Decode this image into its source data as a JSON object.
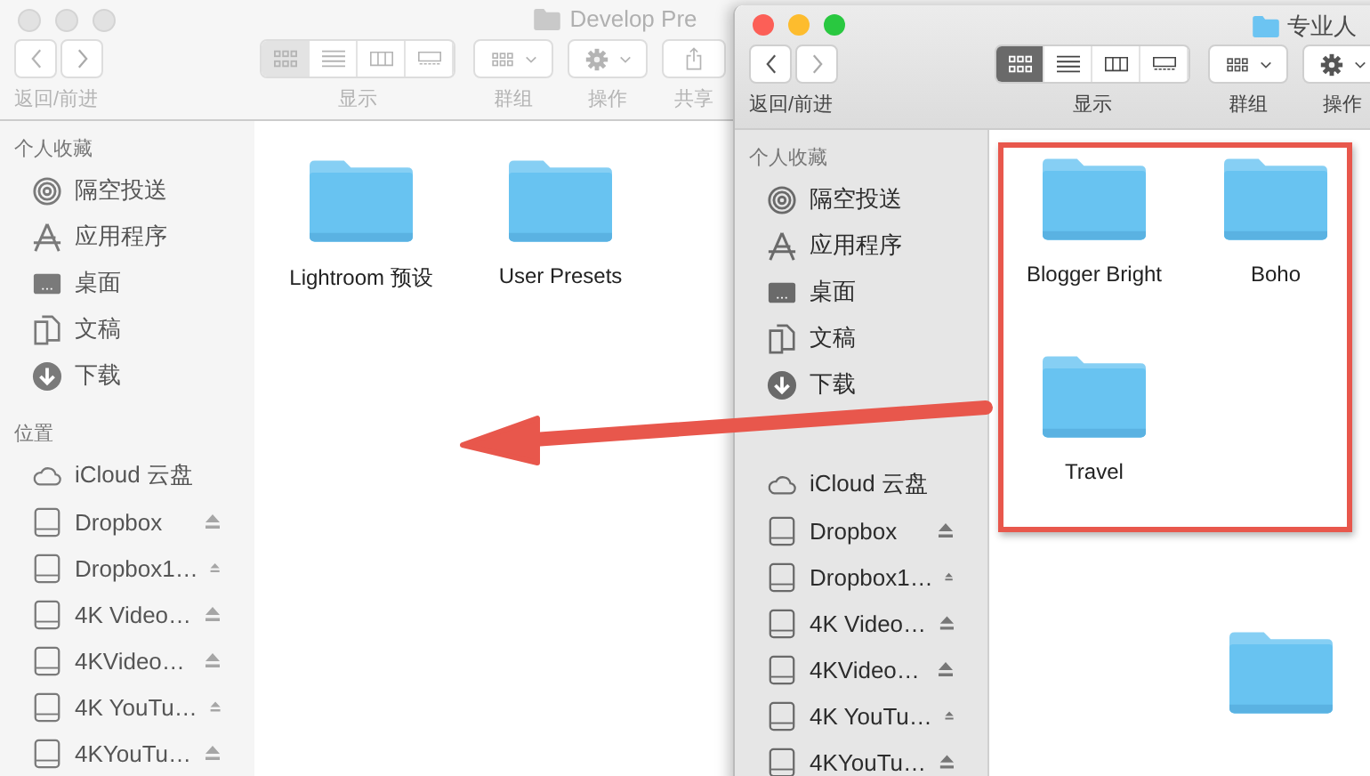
{
  "windows": [
    {
      "title": "Develop Pre",
      "active": false,
      "toolbar": {
        "nav_label": "返回/前进",
        "view_label": "显示",
        "group_label": "群组",
        "action_label": "操作",
        "share_label": "共享",
        "view_modes": [
          {
            "kind": "icon",
            "selected": true
          },
          {
            "kind": "list",
            "selected": false
          },
          {
            "kind": "column",
            "selected": false
          },
          {
            "kind": "gallery",
            "selected": false
          }
        ]
      },
      "sidebar": [
        {
          "heading": "个人收藏",
          "items": [
            {
              "kind": "airdrop",
              "label": "隔空投送"
            },
            {
              "kind": "apps",
              "label": "应用程序"
            },
            {
              "kind": "desktop",
              "label": "桌面"
            },
            {
              "kind": "documents",
              "label": "文稿"
            },
            {
              "kind": "downloads",
              "label": "下载"
            }
          ]
        },
        {
          "heading": "位置",
          "items": [
            {
              "kind": "icloud",
              "label": "iCloud 云盘"
            },
            {
              "kind": "disk",
              "label": "Dropbox"
            },
            {
              "kind": "disk",
              "label": "Dropbox1…"
            },
            {
              "kind": "disk",
              "label": "4K Video…"
            },
            {
              "kind": "disk",
              "label": "4KVideo…"
            },
            {
              "kind": "disk",
              "label": "4K YouTu…"
            },
            {
              "kind": "disk",
              "label": "4KYouTu…"
            }
          ]
        }
      ],
      "groups": [
        {
          "highlighted": false,
          "items": [
            {
              "kind": "folder",
              "name": "Lightroom 预设"
            },
            {
              "kind": "folder",
              "name": "User Presets"
            }
          ]
        }
      ]
    },
    {
      "title": "专业人",
      "active": true,
      "toolbar": {
        "nav_label": "返回/前进",
        "view_label": "显示",
        "group_label": "群组",
        "action_label": "操作",
        "view_modes": [
          {
            "kind": "icon",
            "selected": true
          },
          {
            "kind": "list",
            "selected": false
          },
          {
            "kind": "column",
            "selected": false
          },
          {
            "kind": "gallery",
            "selected": false
          }
        ]
      },
      "sidebar": [
        {
          "heading": "个人收藏",
          "items": [
            {
              "kind": "airdrop",
              "label": "隔空投送"
            },
            {
              "kind": "apps",
              "label": "应用程序"
            },
            {
              "kind": "desktop",
              "label": "桌面"
            },
            {
              "kind": "documents",
              "label": "文稿"
            },
            {
              "kind": "downloads",
              "label": "下载"
            }
          ]
        },
        {
          "items": [
            {
              "kind": "icloud",
              "label": "iCloud 云盘"
            },
            {
              "kind": "disk",
              "label": "Dropbox"
            },
            {
              "kind": "disk",
              "label": "Dropbox1…"
            },
            {
              "kind": "disk",
              "label": "4K Video…"
            },
            {
              "kind": "disk",
              "label": "4KVideo…"
            },
            {
              "kind": "disk",
              "label": "4K YouTu…"
            },
            {
              "kind": "disk",
              "label": "4KYouTu…"
            }
          ]
        }
      ],
      "groups": [
        {
          "highlighted": true,
          "items": [
            {
              "kind": "folder",
              "name": "Blogger Bright"
            },
            {
              "kind": "folder",
              "name": "Boho"
            },
            {
              "kind": "folder",
              "name": "Travel"
            }
          ]
        },
        {
          "highlighted": false,
          "items": [
            {
              "kind": "spacer"
            },
            {
              "kind": "folder"
            }
          ]
        }
      ]
    }
  ]
}
